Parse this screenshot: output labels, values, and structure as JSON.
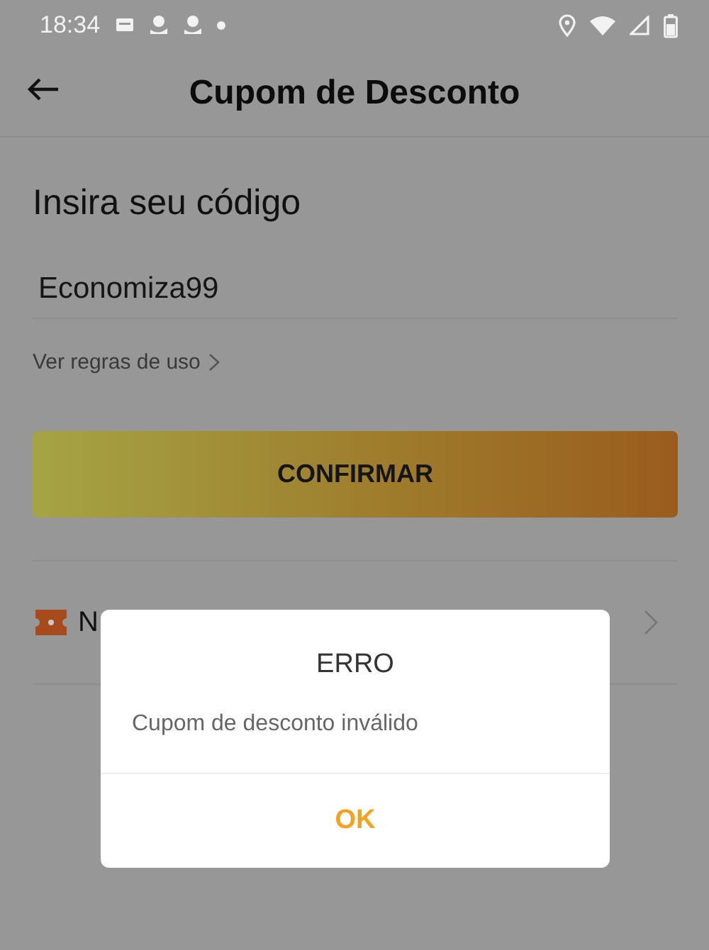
{
  "status_bar": {
    "time": "18:34"
  },
  "header": {
    "title": "Cupom de Desconto"
  },
  "form": {
    "heading": "Insira seu código",
    "code_value": "Economiza99",
    "rules_link": "Ver regras de uso",
    "confirm_button": "CONFIRMAR"
  },
  "list_row": {
    "label": "N"
  },
  "dialog": {
    "title": "ERRO",
    "message": "Cupom de desconto inválido",
    "button": "OK"
  }
}
